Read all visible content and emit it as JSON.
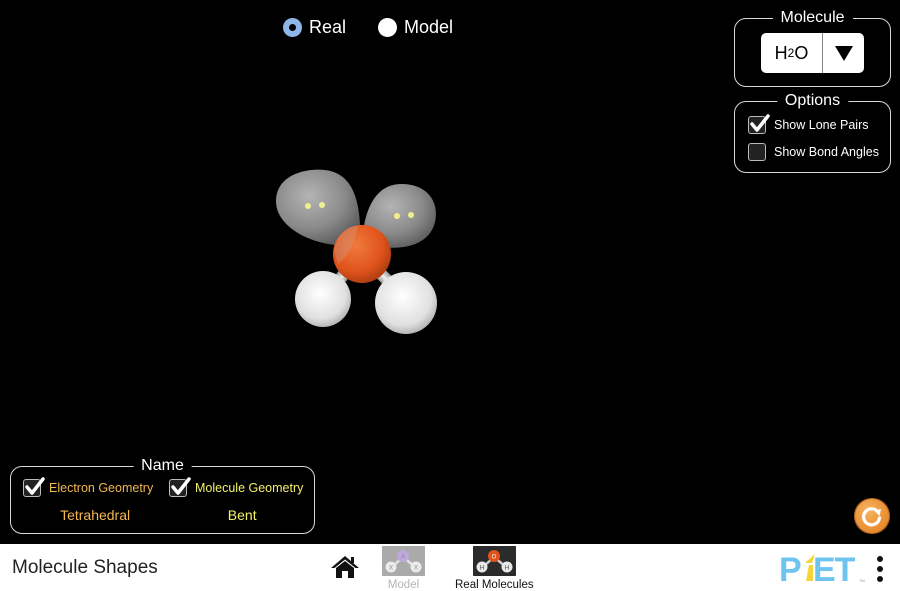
{
  "view_mode": {
    "options": [
      {
        "label": "Real",
        "selected": true
      },
      {
        "label": "Model",
        "selected": false
      }
    ]
  },
  "molecule_panel": {
    "title": "Molecule",
    "selected_molecule": {
      "main": "H",
      "subscript": "2",
      "tail": "O"
    },
    "dropdown_icon": "triangle-down-icon"
  },
  "options_panel": {
    "title": "Options",
    "items": [
      {
        "label": "Show Lone Pairs",
        "checked": true
      },
      {
        "label": "Show Bond Angles",
        "checked": false
      }
    ]
  },
  "name_panel": {
    "title": "Name",
    "electron_geometry": {
      "label": "Electron Geometry",
      "checked": true,
      "value": "Tetrahedral",
      "color": "#f3b84f"
    },
    "molecule_geometry": {
      "label": "Molecule Geometry",
      "checked": true,
      "value": "Bent",
      "color": "#f5f06b"
    }
  },
  "molecule": {
    "central_atom": {
      "element": "O",
      "color": "#e3541e"
    },
    "bonded_atoms": [
      {
        "element": "H"
      },
      {
        "element": "H"
      }
    ],
    "lone_pairs": 2
  },
  "reset_button": {
    "icon": "reset-icon",
    "color": "#e6892d"
  },
  "navbar": {
    "sim_title": "Molecule Shapes",
    "home_icon": "home-icon",
    "tabs": [
      {
        "label": "Model",
        "active": false,
        "thumb_labels": [
          "A",
          "X",
          "X"
        ]
      },
      {
        "label": "Real Molecules",
        "active": true,
        "thumb_labels": [
          "O",
          "H",
          "H"
        ]
      }
    ],
    "logo_text": "PhET",
    "menu_icon": "kebab-menu-icon"
  }
}
